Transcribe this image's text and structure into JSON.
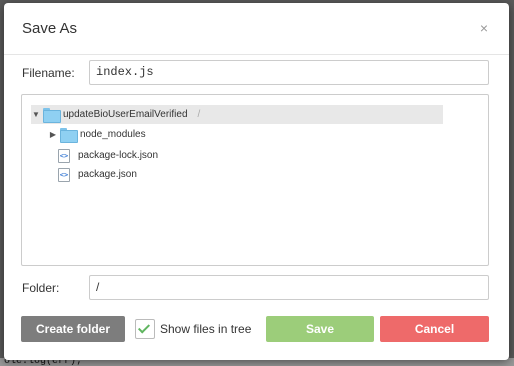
{
  "background": {
    "editor_snippet": "ole.log(err);"
  },
  "dialog": {
    "title": "Save As",
    "close_glyph": "×",
    "filename_label": "Filename:",
    "filename_value": "index.js",
    "folder_label": "Folder:",
    "folder_value": "/"
  },
  "tree": {
    "root": {
      "label": "updateBioUserEmailVerified",
      "path": "/",
      "expanded": true,
      "selected": true
    },
    "items": [
      {
        "type": "folder",
        "label": "node_modules",
        "expanded": false
      },
      {
        "type": "file",
        "label": "package-lock.json",
        "icon": "code-file-icon"
      },
      {
        "type": "file",
        "label": "package.json",
        "icon": "code-file-icon"
      }
    ]
  },
  "footer": {
    "create_folder_label": "Create folder",
    "show_files_label": "Show files in tree",
    "show_files_checked": true,
    "save_label": "Save",
    "cancel_label": "Cancel"
  },
  "colors": {
    "save": "#9ccd7a",
    "cancel": "#ee6a6a",
    "create_folder": "#7d7d7d",
    "folder": "#8fd0f2"
  }
}
